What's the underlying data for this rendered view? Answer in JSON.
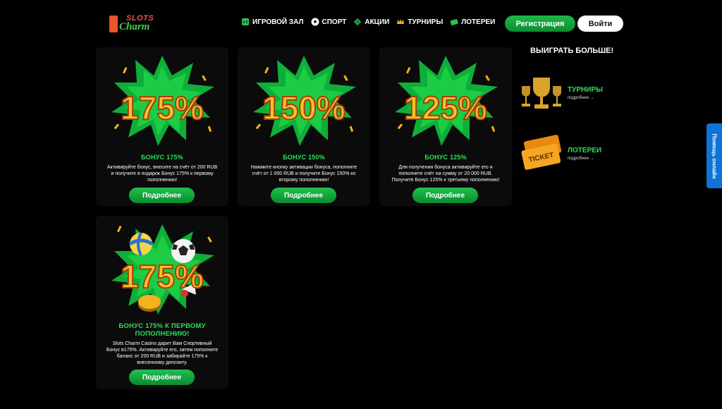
{
  "header": {
    "logo": {
      "top": "SLOTS",
      "bottom": "Charm"
    },
    "nav": [
      {
        "label": "ИГРОВОЙ ЗАЛ",
        "icon": "slots-icon"
      },
      {
        "label": "СПОРТ",
        "icon": "soccer-ball-icon"
      },
      {
        "label": "АКЦИИ",
        "icon": "promotions-icon"
      },
      {
        "label": "ТУРНИРЫ",
        "icon": "crown-icon"
      },
      {
        "label": "ЛОТЕРЕИ",
        "icon": "ticket-icon"
      }
    ],
    "register_label": "Регистрация",
    "login_label": "Войти"
  },
  "cards": [
    {
      "art_text": "175%",
      "title": "БОНУС 175%",
      "desc": [
        "Активируйте бонус, внесите на счёт от 200 RUB",
        "и получите в подарок Бонус 175% к первому",
        "пополнению!"
      ],
      "button": "Подробнее"
    },
    {
      "art_text": "150%",
      "title": "БОНУС 150%",
      "desc": [
        "Нажмите кнопку активации бонуса, пополните",
        "счёт от 1 000 RUB и получите Бонус 150% ко",
        "второму пополнению!"
      ],
      "button": "Подробнее"
    },
    {
      "art_text": "125%",
      "title": "БОНУС 125%",
      "desc": [
        "Для получения бонуса активируйте его и",
        "пополните счёт на сумму от 20 000 RUB.",
        "Получите Бонус 125% к третьему пополнению!"
      ],
      "button": "Подробнее"
    },
    {
      "art_text": "175%",
      "title": [
        "БОНУС 175% К ПЕРВОМУ",
        "ПОПОЛНЕНИЮ!"
      ],
      "desc": [
        "Slots Charm Casino дарит Вам Спортивный",
        "Бонус в175%. Активируйте его, затем пополните",
        "баланс от 200 RUB и забирайте 175% к",
        "внесенному депозиту."
      ],
      "button": "Подробнее"
    }
  ],
  "sidebar": {
    "heading": "ВЫИГРАТЬ БОЛЬШЕ!",
    "promos": [
      {
        "title": "ТУРНИРЫ",
        "more": "подробнее",
        "icon": "trophy-icon"
      },
      {
        "title": "ЛОТЕРЕИ",
        "more": "подробнее",
        "icon": "ticket-icon",
        "ticket_text": "TICKET"
      }
    ]
  },
  "help_label": "Помощь онлайн",
  "colors": {
    "accent_green": "#2fe05a",
    "button_green": "#1fb84a",
    "help_blue": "#0b74d6",
    "gold": "#f5b21a"
  }
}
